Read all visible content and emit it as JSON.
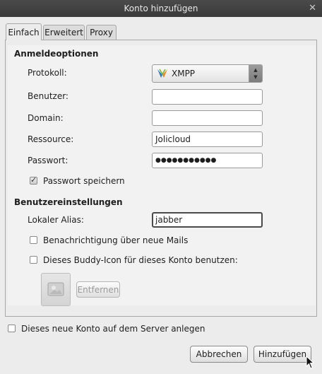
{
  "window": {
    "title": "Konto hinzufügen",
    "close_glyph": "✕"
  },
  "tabs": [
    {
      "label": "Einfach",
      "active": true
    },
    {
      "label": "Erweitert",
      "active": false
    },
    {
      "label": "Proxy",
      "active": false
    }
  ],
  "login_options": {
    "heading": "Anmeldeoptionen",
    "protocol": {
      "label": "Protokoll:",
      "value": "XMPP",
      "icon": "xmpp-icon"
    },
    "user": {
      "label": "Benutzer:",
      "value": ""
    },
    "domain": {
      "label": "Domain:",
      "value": ""
    },
    "resource": {
      "label": "Ressource:",
      "value": "Jolicloud"
    },
    "password": {
      "label": "Passwort:",
      "value": "●●●●●●●●●●●"
    },
    "save_password": {
      "label": "Passwort speichern",
      "checked": true
    }
  },
  "user_settings": {
    "heading": "Benutzereinstellungen",
    "alias": {
      "label": "Lokaler Alias:",
      "value": "jabber"
    },
    "new_mail": {
      "label": "Benachrichtigung über neue Mails",
      "checked": false
    },
    "buddy_icon": {
      "label": "Dieses Buddy-Icon für dieses Konto benutzen:",
      "checked": false
    },
    "remove_label": "Entfernen"
  },
  "create_on_server": {
    "label": "Dieses neue Konto auf dem Server anlegen",
    "checked": false
  },
  "buttons": {
    "cancel": "Abbrechen",
    "add": "Hinzufügen"
  }
}
